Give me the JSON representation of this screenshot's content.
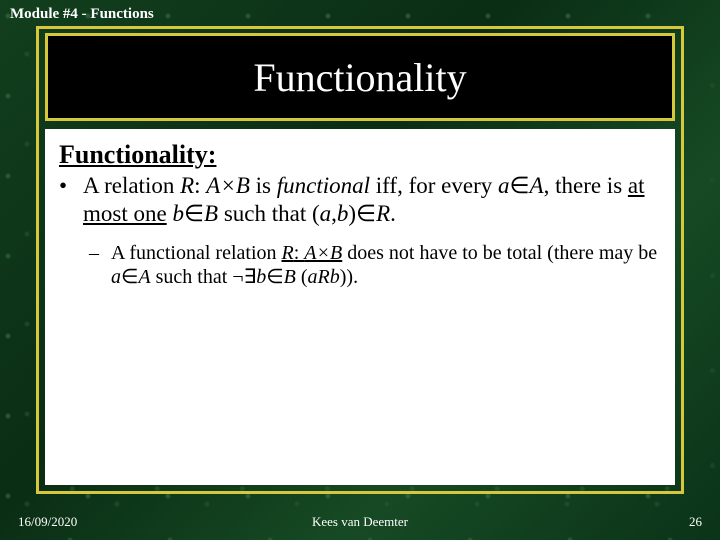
{
  "module_label": "Module #4 - Functions",
  "title": "Functionality",
  "heading": "Functionality:",
  "bullet1_dot": "•",
  "b1_t1": "A relation ",
  "b1_R": "R",
  "b1_colon1": ": ",
  "b1_AxB": "A×B",
  "b1_t2": " is ",
  "b1_functional": "functional",
  "b1_t3": " iff, for every ",
  "b1_a": "a",
  "b1_in1": "∈",
  "b1_A": "A",
  "b1_t4": ", there is ",
  "b1_atmostone": "at most one",
  "b1_sp": "  ",
  "b1_b": "b",
  "b1_in2": "∈",
  "b1_B": "B",
  "b1_t5": " such that (",
  "b1_a2": "a",
  "b1_comma": ",",
  "b1_b2": "b",
  "b1_t6": ")∈",
  "b1_R2": "R",
  "b1_t7": ".",
  "bullet2_dash": "–",
  "b2_t1": "A functional relation ",
  "b2_R": "R",
  "b2_colon": ": ",
  "b2_AxB": "A×B",
  "b2_t2": " does not have to be total (there may be ",
  "b2_a": "a",
  "b2_in1": "∈",
  "b2_A": "A",
  "b2_t3": " such that ¬∃",
  "b2_b": "b",
  "b2_in2": "∈",
  "b2_B": "B",
  "b2_t4": " (",
  "b2_aRb": "aRb",
  "b2_t5": ")).",
  "footer_date": "16/09/2020",
  "footer_author": "Kees van Deemter",
  "footer_page": "26"
}
